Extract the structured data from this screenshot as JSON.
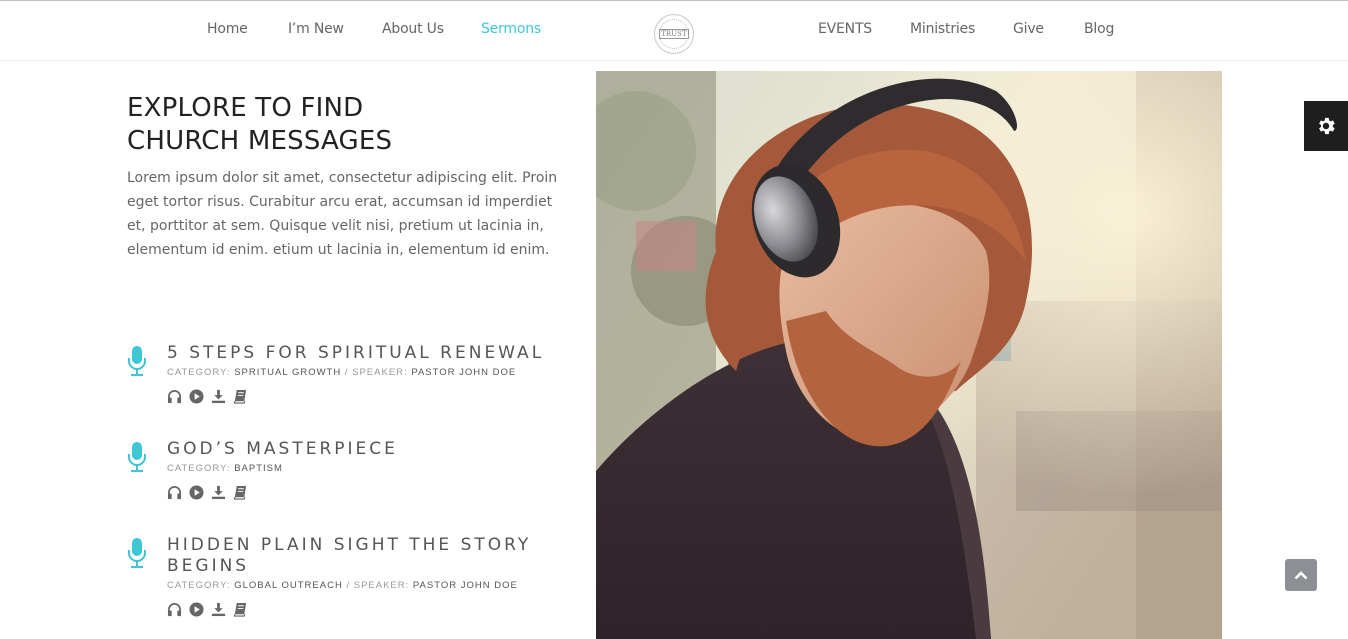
{
  "nav": {
    "left": [
      {
        "label": "Home"
      },
      {
        "label": "I’m New"
      },
      {
        "label": "About Us"
      },
      {
        "label": "Sermons",
        "active": true
      }
    ],
    "right": [
      {
        "label": "EVENTS"
      },
      {
        "label": "Ministries"
      },
      {
        "label": "Give"
      },
      {
        "label": "Blog"
      }
    ],
    "logo_text": "TRUST"
  },
  "intro": {
    "title_line1": "EXPLORE TO FIND",
    "title_line2": "CHURCH MESSAGES",
    "body": "Lorem ipsum dolor sit amet, consectetur adipiscing elit. Proin eget tortor risus. Curabitur arcu erat, accumsan id imperdiet et, porttitor at sem. Quisque velit nisi, pretium ut lacinia in, elementum id enim. etium ut lacinia in, elementum id enim."
  },
  "sermons": [
    {
      "title": "5 STEPS FOR SPIRITUAL RENEWAL",
      "category_label": "CATEGORY:",
      "category": "SPRITUAL GROWTH",
      "speaker_label": "/ SPEAKER:",
      "speaker": "PASTOR JOHN DOE"
    },
    {
      "title": "GOD’S MASTERPIECE",
      "category_label": "CATEGORY:",
      "category": "BAPTISM",
      "speaker_label": "",
      "speaker": ""
    },
    {
      "title": "HIDDEN PLAIN SIGHT THE STORY BEGINS",
      "category_label": "CATEGORY:",
      "category": "GLOBAL OUTREACH",
      "speaker_label": "/ SPEAKER:",
      "speaker": "PASTOR JOHN DOE"
    }
  ],
  "icons": {
    "sermon_actions": [
      "headphones-icon",
      "play-icon",
      "download-icon",
      "book-icon"
    ],
    "sermon_type": "microphone-icon",
    "settings": "gear-icon",
    "scroll_top": "chevron-up-icon"
  },
  "colors": {
    "accent": "#3fc6d6",
    "text_dark": "#222222",
    "settings_bg": "#1e1e1e",
    "scroll_top_bg": "#8c8f93"
  }
}
